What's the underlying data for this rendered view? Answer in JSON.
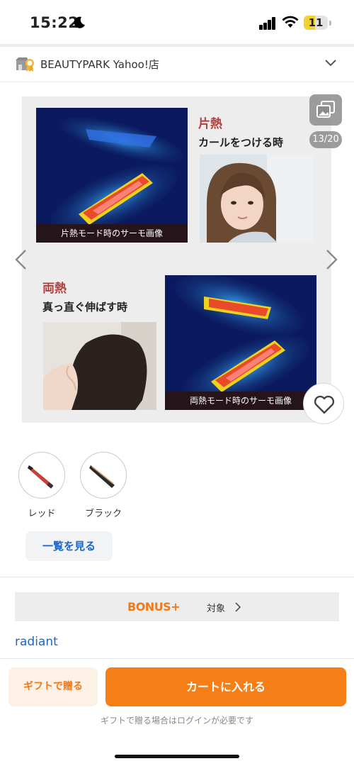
{
  "status_bar": {
    "time": "15:22",
    "battery": "11",
    "icons": [
      "moon-icon",
      "signal-icon",
      "wifi-icon",
      "battery-icon"
    ]
  },
  "store": {
    "name": "BEAUTYPARK Yahoo!店",
    "icon": "store-badge-icon",
    "expand_icon": "chevron-down-icon"
  },
  "gallery": {
    "counter": "13/20",
    "top_panel": {
      "title": "片熱",
      "subtitle": "カールをつける時",
      "caption": "片熱モード時のサーモ画像"
    },
    "bottom_panel": {
      "title": "両熱",
      "subtitle": "真っ直ぐ伸ばす時",
      "caption": "両熱モード時のサーモ画像"
    }
  },
  "variants": {
    "items": [
      {
        "label": "レッド",
        "color": "#c6403a"
      },
      {
        "label": "ブラック",
        "color": "#2a2a2a"
      }
    ],
    "view_all_label": "一覧を見る"
  },
  "bonus": {
    "logo": "BONUS+",
    "text": "対象",
    "color": "#ef7a1a"
  },
  "brand": {
    "name": "radiant"
  },
  "footer": {
    "gift_label": "ギフトで贈る",
    "cart_label": "カートに入れる",
    "note": "ギフトで贈る場合はログインが必要です",
    "accent": "#f57f16"
  }
}
